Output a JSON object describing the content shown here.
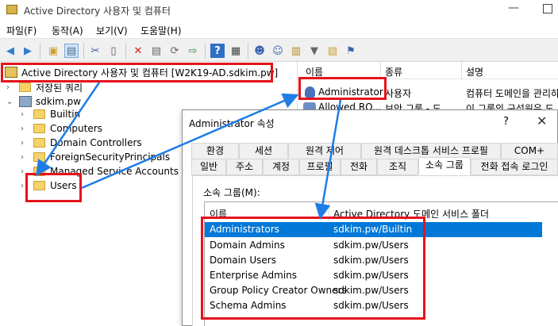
{
  "window": {
    "title": "Active Directory 사용자 및 컴퓨터"
  },
  "menu": [
    "파일(F)",
    "동작(A)",
    "보기(V)",
    "도움말(H)"
  ],
  "toolbar_icons": [
    "back-arrow-icon",
    "forward-arrow-icon",
    "up-folder-icon",
    "console-tree-icon",
    "cut-icon",
    "copy-icon",
    "delete-icon",
    "properties-icon",
    "refresh-icon",
    "export-icon",
    "help-icon",
    "console-icon",
    "add-user-icon",
    "add-group-icon",
    "find-icon",
    "filter-icon",
    "add-to-group-icon",
    "move-icon"
  ],
  "tree": {
    "root": "Active Directory 사용자 및 컴퓨터 [W2K19-AD.sdkim.pw]",
    "saved_queries": "저장된 쿼리",
    "domain": "sdkim.pw",
    "children": [
      "Builtin",
      "Computers",
      "Domain Controllers",
      "ForeignSecurityPrincipals",
      "Managed Service Accounts",
      "Users"
    ]
  },
  "list": {
    "headers": [
      "이름",
      "종류",
      "설명"
    ],
    "rows": [
      {
        "name": "Administrator",
        "type": "사용자",
        "desc": "컴퓨터 도메인을 관리하"
      },
      {
        "name": "Allowed RO...",
        "type": "보안 그룹 - 도...",
        "desc": "이 그룹의 구성원은 도"
      }
    ]
  },
  "dialog": {
    "title": "Administrator 속성",
    "help": "?",
    "close": "✕",
    "tabs_row1": [
      "환경",
      "세션",
      "원격 제어",
      "원격 데스크톱 서비스 프로필",
      "COM+"
    ],
    "tabs_row2": [
      "일반",
      "주소",
      "계정",
      "프로필",
      "전화",
      "조직",
      "소속 그룹",
      "전화 접속 로그인"
    ],
    "active_tab": "소속 그룹",
    "member_of_label": "소속 그룹(M):",
    "columns": [
      "이름",
      "Active Directory 도메인 서비스 폴더"
    ],
    "groups": [
      {
        "name": "Administrators",
        "folder": "sdkim.pw/Builtin"
      },
      {
        "name": "Domain Admins",
        "folder": "sdkim.pw/Users"
      },
      {
        "name": "Domain Users",
        "folder": "sdkim.pw/Users"
      },
      {
        "name": "Enterprise Admins",
        "folder": "sdkim.pw/Users"
      },
      {
        "name": "Group Policy Creator Owners",
        "folder": "sdkim.pw/Users"
      },
      {
        "name": "Schema Admins",
        "folder": "sdkim.pw/Users"
      }
    ]
  },
  "colors": {
    "annotation_red": "#e5131c",
    "annotation_blue": "#1e7de6",
    "selection": "#0078d7"
  }
}
